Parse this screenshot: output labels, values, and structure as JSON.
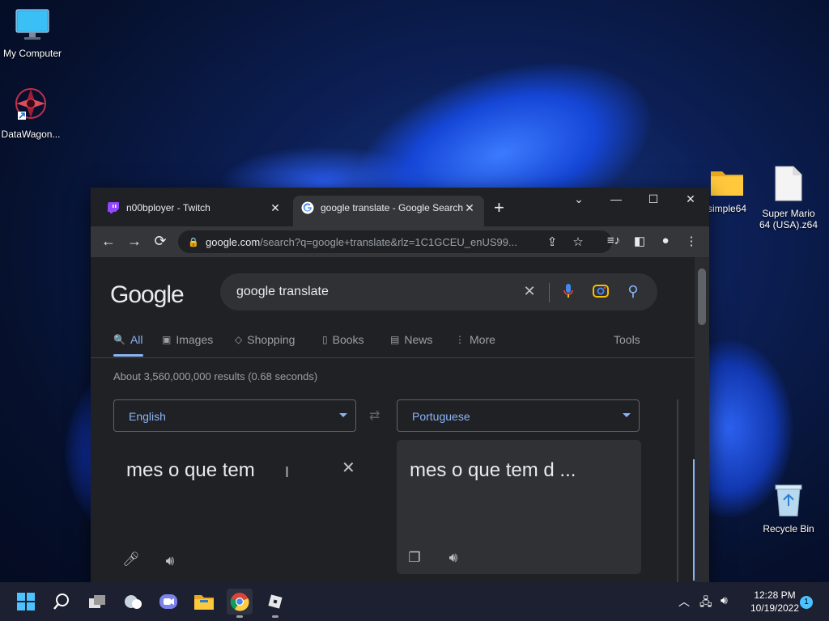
{
  "desktop": {
    "icons": [
      {
        "label": "My Computer"
      },
      {
        "label": "DataWagon..."
      },
      {
        "label": "simple64"
      },
      {
        "label": "Super Mario 64 (USA).z64"
      },
      {
        "label": "Recycle Bin"
      }
    ]
  },
  "browser": {
    "tabs": [
      {
        "title": "n00bployer - Twitch",
        "close": "✕"
      },
      {
        "title": "google translate - Google Search",
        "close": "✕"
      }
    ],
    "new_tab": "+",
    "window_controls": {
      "tabsearch": "⌄",
      "minimize": "—",
      "maximize": "☐",
      "close": "✕"
    },
    "nav": {
      "back": "←",
      "forward": "→",
      "reload": "⟳"
    },
    "address": {
      "host": "google.com",
      "path": "/search?q=google+translate&rlz=1C1GCEU_enUS99..."
    }
  },
  "google": {
    "logo": "Google",
    "query": "google translate",
    "tabs": [
      {
        "label": "All",
        "icon": "🔍"
      },
      {
        "label": "Images",
        "icon": "▣"
      },
      {
        "label": "Shopping",
        "icon": "◇"
      },
      {
        "label": "Books",
        "icon": "▯"
      },
      {
        "label": "News",
        "icon": "▤"
      },
      {
        "label": "More",
        "icon": "⋮"
      }
    ],
    "tools": "Tools",
    "stats": "About 3,560,000,000 results (0.68 seconds)",
    "translate": {
      "source_lang": "English",
      "target_lang": "Portuguese",
      "source_text": "mes o que tem",
      "target_text": "mes o que tem d ..."
    }
  },
  "taskbar": {
    "time": "12:28 PM",
    "date": "10/19/2022",
    "notifications": "1"
  },
  "colors": {
    "accent": "#8ab4f8",
    "page_bg": "#202124",
    "toolbar_bg": "#35363a"
  }
}
